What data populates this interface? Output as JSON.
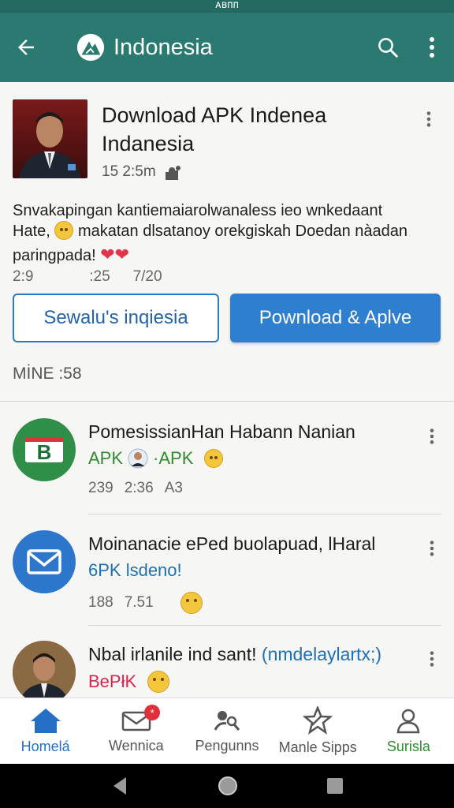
{
  "status_bar": {
    "text": "ᴀʙᴨᴨ"
  },
  "app_bar": {
    "title": "Indonesia",
    "back_icon": "arrow-left-icon",
    "search_icon": "search-icon",
    "more_icon": "more-vert-icon"
  },
  "featured": {
    "title": "Download APK Indenea Indanesia",
    "meta_time": "15 2:5m",
    "description_line1": "Snvakapingan kantiemaiarolwanaless ieo wnkedaant",
    "description_line2": "Hate,",
    "description_line2b": "makatan dlsatanoy orekgiskah Doedan nàadan",
    "description_line3": "paringpada!",
    "stats": [
      "2:9",
      ":25",
      "7/20"
    ],
    "button_secondary": "Sewalu's inqiesia",
    "button_primary": "Pownload & Aplve"
  },
  "section_label": "MİNE :58",
  "items": [
    {
      "title": "PomesissianHan Habann Nanian",
      "sub_a": "APK",
      "sub_b": "·APK",
      "meta": [
        "239",
        "2:36",
        "A3"
      ],
      "sub_color": "#2e8b2e"
    },
    {
      "title": "Moinanacie ePed buolapuad, lHaral",
      "sub_a": "6PK lsdeno!",
      "meta": [
        "188",
        "7.51"
      ],
      "sub_color": "#1f6fb4"
    },
    {
      "title": "Nbal irlanile ind sant!",
      "title_tail": "(nmdelaylartx;)",
      "sub_a": "BePłK",
      "sub_color": "#d6264e"
    }
  ],
  "bottom_nav": [
    {
      "label": "Homelá",
      "icon": "home-icon",
      "active": true
    },
    {
      "label": "Wennica",
      "icon": "mail-icon",
      "badge": "*"
    },
    {
      "label": "Pengunns",
      "icon": "search-people-icon"
    },
    {
      "label": "Manle Sipps",
      "icon": "star-icon"
    },
    {
      "label": "Surisla",
      "icon": "person-icon"
    }
  ],
  "colors": {
    "app_bar": "#2a7a72",
    "accent": "#2f7fd1",
    "link_green": "#2e8b2e"
  }
}
